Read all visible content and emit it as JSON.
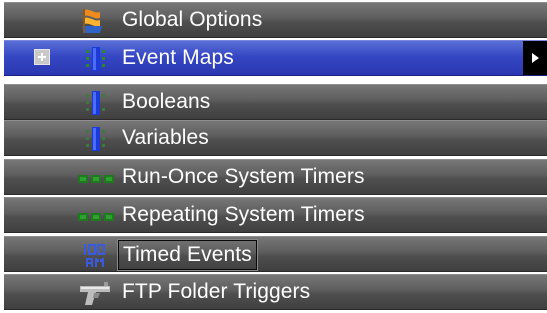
{
  "tree": {
    "items": [
      {
        "label": "Global Options",
        "icon": "global-options-icon"
      },
      {
        "label": "Event Maps",
        "icon": "event-maps-icon",
        "selected": true,
        "expandable": true,
        "has_submenu": true
      },
      {
        "label": "Booleans",
        "icon": "booleans-icon"
      },
      {
        "label": "Variables",
        "icon": "variables-icon"
      },
      {
        "label": "Run-Once System Timers",
        "icon": "run-once-timer-icon"
      },
      {
        "label": "Repeating System Timers",
        "icon": "repeating-timer-icon"
      },
      {
        "label": "Timed Events",
        "icon": "timed-events-icon",
        "focused": true
      },
      {
        "label": "FTP Folder Triggers",
        "icon": "ftp-folder-trigger-icon"
      }
    ]
  },
  "colors": {
    "row_top": "#777777",
    "row_bottom": "#404040",
    "selected_top": "#5a6fd6",
    "selected_bottom": "#2a37b0",
    "text": "#ffffff",
    "timer_icon_green": "#1f7a1f"
  }
}
